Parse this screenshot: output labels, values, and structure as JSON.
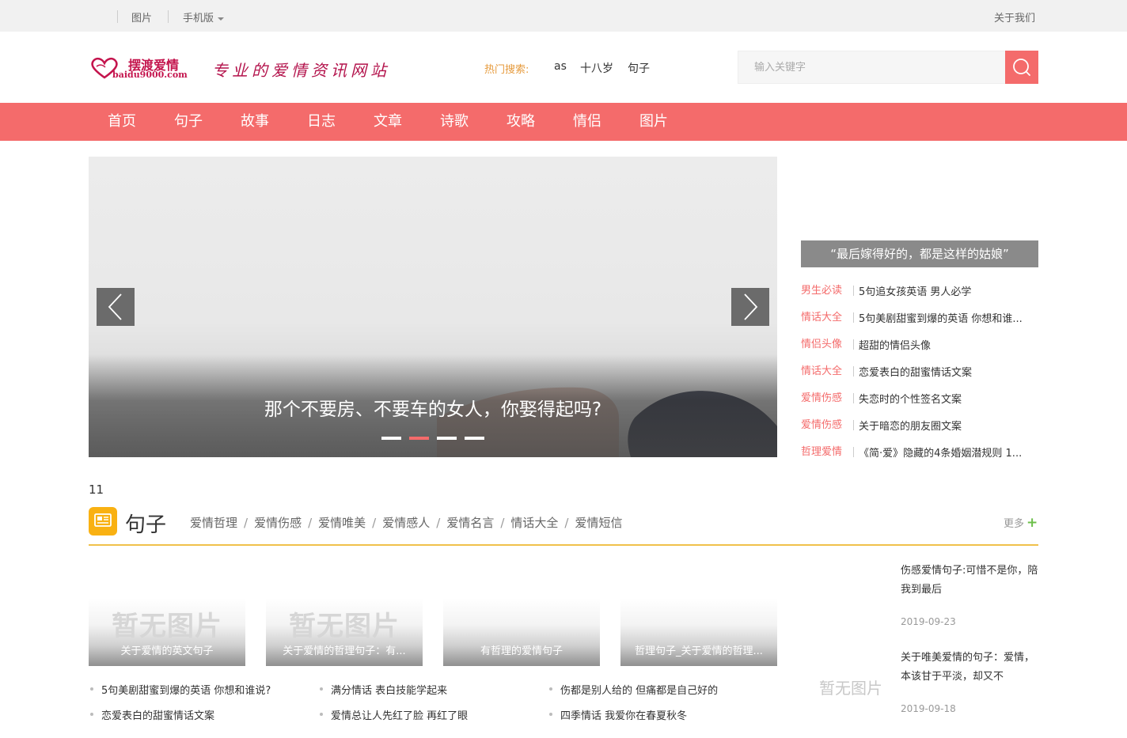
{
  "topbar": {
    "pics": "图片",
    "mobile": "手机版",
    "about": "关于我们"
  },
  "logo": {
    "cn": "摆渡爱情",
    "en": "baidu9000.com"
  },
  "slogan": "专业的爱情资讯网站",
  "hot": {
    "label": "热门搜索:",
    "items": [
      "as",
      "十八岁",
      "句子"
    ]
  },
  "search": {
    "placeholder": "输入关键字"
  },
  "nav": [
    "首页",
    "句子",
    "故事",
    "日志",
    "文章",
    "诗歌",
    "攻略",
    "情侣",
    "图片"
  ],
  "slider": {
    "caption": "那个不要房、不要车的女人，你娶得起吗?",
    "active_dot": 2,
    "dot_count": 4
  },
  "feature": {
    "title": "“最后嫁得好的，都是这样的姑娘”",
    "items": [
      {
        "cat": "男生必读",
        "title": "5句追女孩英语 男人必学"
      },
      {
        "cat": "情话大全",
        "title": "5句美剧甜蜜到爆的英语 你想和谁..."
      },
      {
        "cat": "情侣头像",
        "title": "超甜的情侣头像"
      },
      {
        "cat": "情话大全",
        "title": "恋爱表白的甜蜜情话文案"
      },
      {
        "cat": "爱情伤感",
        "title": "失恋时的个性签名文案"
      },
      {
        "cat": "爱情伤感",
        "title": "关于暗恋的朋友圈文案"
      },
      {
        "cat": "哲理爱情",
        "title": "《简·爱》隐藏的4条婚姻潜规则 1..."
      }
    ]
  },
  "section": {
    "num": "11",
    "title": "句子",
    "tags": [
      "爱情哲理",
      "爱情伤感",
      "爱情唯美",
      "爱情感人",
      "爱情名言",
      "情话大全",
      "爱情短信"
    ],
    "more": "更多",
    "cards": [
      {
        "placeholder": "暂无图片",
        "caption": "关于爱情的英文句子"
      },
      {
        "placeholder": "暂无图片",
        "caption": "关于爱情的哲理句子：有..."
      },
      {
        "placeholder": "",
        "caption": "有哲理的爱情句子"
      },
      {
        "placeholder": "",
        "caption": "哲理句子_关于爱情的哲理..."
      }
    ],
    "lists": [
      [
        "5句美剧甜蜜到爆的英语 你想和谁说?",
        "恋爱表白的甜蜜情话文案"
      ],
      [
        "满分情话 表白技能学起来",
        "爱情总让人先红了脸 再红了眼"
      ],
      [
        "伤都是别人给的 但痛都是自己好的",
        "四季情话 我爱你在春夏秋冬"
      ]
    ],
    "side_placeholder": "暂无图片",
    "side_articles": [
      {
        "title": "伤感爱情句子:可惜不是你，陪我到最后",
        "date": "2019-09-23"
      },
      {
        "title": "关于唯美爱情的句子：爱情，本该甘于平淡，却又不",
        "date": "2019-09-18"
      }
    ]
  }
}
